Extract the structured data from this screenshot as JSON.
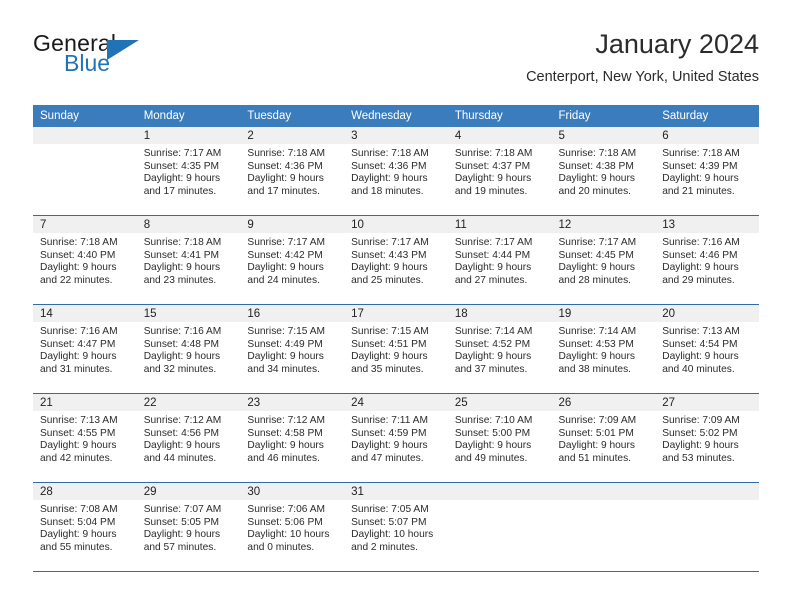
{
  "brand": {
    "name_top": "General",
    "name_bottom": "Blue",
    "accent_color": "#2272b8"
  },
  "header": {
    "title": "January 2024",
    "subtitle": "Centerport, New York, United States"
  },
  "calendar": {
    "header_bg": "#3b7cbd",
    "daynum_bg": "#f0f0f0",
    "separator_color": "#2e6da8",
    "weekday_names": [
      "Sunday",
      "Monday",
      "Tuesday",
      "Wednesday",
      "Thursday",
      "Friday",
      "Saturday"
    ],
    "weeks": [
      [
        {
          "day": ""
        },
        {
          "day": "1",
          "sunrise": "Sunrise: 7:17 AM",
          "sunset": "Sunset: 4:35 PM",
          "daylight_line1": "Daylight: 9 hours",
          "daylight_line2": "and 17 minutes."
        },
        {
          "day": "2",
          "sunrise": "Sunrise: 7:18 AM",
          "sunset": "Sunset: 4:36 PM",
          "daylight_line1": "Daylight: 9 hours",
          "daylight_line2": "and 17 minutes."
        },
        {
          "day": "3",
          "sunrise": "Sunrise: 7:18 AM",
          "sunset": "Sunset: 4:36 PM",
          "daylight_line1": "Daylight: 9 hours",
          "daylight_line2": "and 18 minutes."
        },
        {
          "day": "4",
          "sunrise": "Sunrise: 7:18 AM",
          "sunset": "Sunset: 4:37 PM",
          "daylight_line1": "Daylight: 9 hours",
          "daylight_line2": "and 19 minutes."
        },
        {
          "day": "5",
          "sunrise": "Sunrise: 7:18 AM",
          "sunset": "Sunset: 4:38 PM",
          "daylight_line1": "Daylight: 9 hours",
          "daylight_line2": "and 20 minutes."
        },
        {
          "day": "6",
          "sunrise": "Sunrise: 7:18 AM",
          "sunset": "Sunset: 4:39 PM",
          "daylight_line1": "Daylight: 9 hours",
          "daylight_line2": "and 21 minutes."
        }
      ],
      [
        {
          "day": "7",
          "sunrise": "Sunrise: 7:18 AM",
          "sunset": "Sunset: 4:40 PM",
          "daylight_line1": "Daylight: 9 hours",
          "daylight_line2": "and 22 minutes."
        },
        {
          "day": "8",
          "sunrise": "Sunrise: 7:18 AM",
          "sunset": "Sunset: 4:41 PM",
          "daylight_line1": "Daylight: 9 hours",
          "daylight_line2": "and 23 minutes."
        },
        {
          "day": "9",
          "sunrise": "Sunrise: 7:17 AM",
          "sunset": "Sunset: 4:42 PM",
          "daylight_line1": "Daylight: 9 hours",
          "daylight_line2": "and 24 minutes."
        },
        {
          "day": "10",
          "sunrise": "Sunrise: 7:17 AM",
          "sunset": "Sunset: 4:43 PM",
          "daylight_line1": "Daylight: 9 hours",
          "daylight_line2": "and 25 minutes."
        },
        {
          "day": "11",
          "sunrise": "Sunrise: 7:17 AM",
          "sunset": "Sunset: 4:44 PM",
          "daylight_line1": "Daylight: 9 hours",
          "daylight_line2": "and 27 minutes."
        },
        {
          "day": "12",
          "sunrise": "Sunrise: 7:17 AM",
          "sunset": "Sunset: 4:45 PM",
          "daylight_line1": "Daylight: 9 hours",
          "daylight_line2": "and 28 minutes."
        },
        {
          "day": "13",
          "sunrise": "Sunrise: 7:16 AM",
          "sunset": "Sunset: 4:46 PM",
          "daylight_line1": "Daylight: 9 hours",
          "daylight_line2": "and 29 minutes."
        }
      ],
      [
        {
          "day": "14",
          "sunrise": "Sunrise: 7:16 AM",
          "sunset": "Sunset: 4:47 PM",
          "daylight_line1": "Daylight: 9 hours",
          "daylight_line2": "and 31 minutes."
        },
        {
          "day": "15",
          "sunrise": "Sunrise: 7:16 AM",
          "sunset": "Sunset: 4:48 PM",
          "daylight_line1": "Daylight: 9 hours",
          "daylight_line2": "and 32 minutes."
        },
        {
          "day": "16",
          "sunrise": "Sunrise: 7:15 AM",
          "sunset": "Sunset: 4:49 PM",
          "daylight_line1": "Daylight: 9 hours",
          "daylight_line2": "and 34 minutes."
        },
        {
          "day": "17",
          "sunrise": "Sunrise: 7:15 AM",
          "sunset": "Sunset: 4:51 PM",
          "daylight_line1": "Daylight: 9 hours",
          "daylight_line2": "and 35 minutes."
        },
        {
          "day": "18",
          "sunrise": "Sunrise: 7:14 AM",
          "sunset": "Sunset: 4:52 PM",
          "daylight_line1": "Daylight: 9 hours",
          "daylight_line2": "and 37 minutes."
        },
        {
          "day": "19",
          "sunrise": "Sunrise: 7:14 AM",
          "sunset": "Sunset: 4:53 PM",
          "daylight_line1": "Daylight: 9 hours",
          "daylight_line2": "and 38 minutes."
        },
        {
          "day": "20",
          "sunrise": "Sunrise: 7:13 AM",
          "sunset": "Sunset: 4:54 PM",
          "daylight_line1": "Daylight: 9 hours",
          "daylight_line2": "and 40 minutes."
        }
      ],
      [
        {
          "day": "21",
          "sunrise": "Sunrise: 7:13 AM",
          "sunset": "Sunset: 4:55 PM",
          "daylight_line1": "Daylight: 9 hours",
          "daylight_line2": "and 42 minutes."
        },
        {
          "day": "22",
          "sunrise": "Sunrise: 7:12 AM",
          "sunset": "Sunset: 4:56 PM",
          "daylight_line1": "Daylight: 9 hours",
          "daylight_line2": "and 44 minutes."
        },
        {
          "day": "23",
          "sunrise": "Sunrise: 7:12 AM",
          "sunset": "Sunset: 4:58 PM",
          "daylight_line1": "Daylight: 9 hours",
          "daylight_line2": "and 46 minutes."
        },
        {
          "day": "24",
          "sunrise": "Sunrise: 7:11 AM",
          "sunset": "Sunset: 4:59 PM",
          "daylight_line1": "Daylight: 9 hours",
          "daylight_line2": "and 47 minutes."
        },
        {
          "day": "25",
          "sunrise": "Sunrise: 7:10 AM",
          "sunset": "Sunset: 5:00 PM",
          "daylight_line1": "Daylight: 9 hours",
          "daylight_line2": "and 49 minutes."
        },
        {
          "day": "26",
          "sunrise": "Sunrise: 7:09 AM",
          "sunset": "Sunset: 5:01 PM",
          "daylight_line1": "Daylight: 9 hours",
          "daylight_line2": "and 51 minutes."
        },
        {
          "day": "27",
          "sunrise": "Sunrise: 7:09 AM",
          "sunset": "Sunset: 5:02 PM",
          "daylight_line1": "Daylight: 9 hours",
          "daylight_line2": "and 53 minutes."
        }
      ],
      [
        {
          "day": "28",
          "sunrise": "Sunrise: 7:08 AM",
          "sunset": "Sunset: 5:04 PM",
          "daylight_line1": "Daylight: 9 hours",
          "daylight_line2": "and 55 minutes."
        },
        {
          "day": "29",
          "sunrise": "Sunrise: 7:07 AM",
          "sunset": "Sunset: 5:05 PM",
          "daylight_line1": "Daylight: 9 hours",
          "daylight_line2": "and 57 minutes."
        },
        {
          "day": "30",
          "sunrise": "Sunrise: 7:06 AM",
          "sunset": "Sunset: 5:06 PM",
          "daylight_line1": "Daylight: 10 hours",
          "daylight_line2": "and 0 minutes."
        },
        {
          "day": "31",
          "sunrise": "Sunrise: 7:05 AM",
          "sunset": "Sunset: 5:07 PM",
          "daylight_line1": "Daylight: 10 hours",
          "daylight_line2": "and 2 minutes."
        },
        {
          "day": ""
        },
        {
          "day": ""
        },
        {
          "day": ""
        }
      ]
    ]
  }
}
